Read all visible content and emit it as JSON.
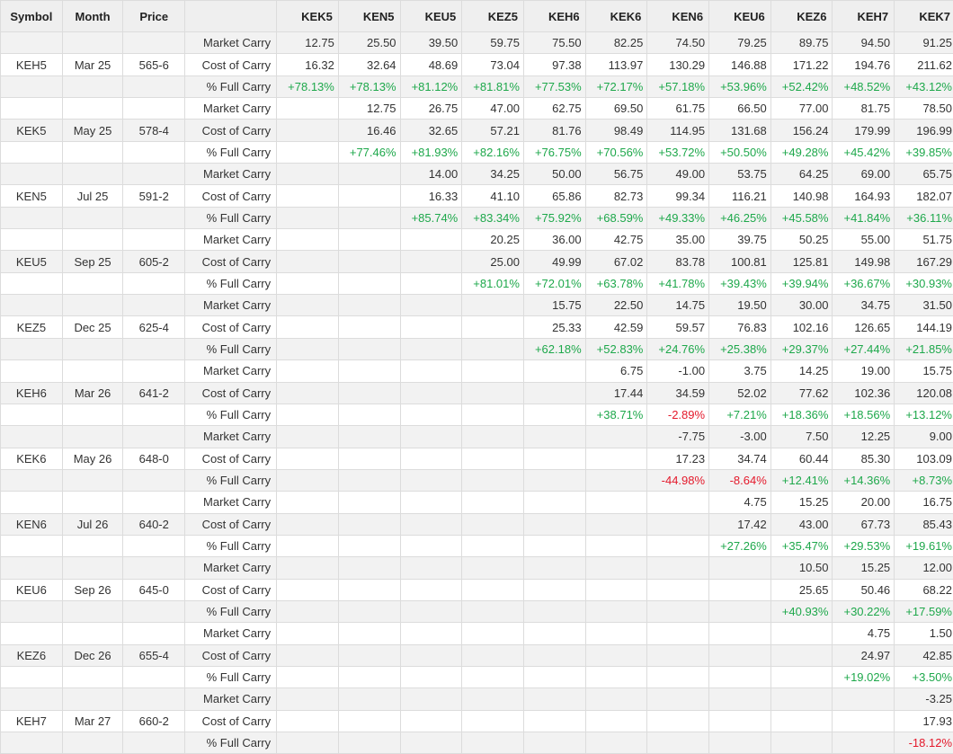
{
  "colors": {
    "positive": "#1ea84b",
    "negative": "#e4192b",
    "header_bg": "#efefef",
    "stripe": "#f2f2f2"
  },
  "headers": {
    "symbol": "Symbol",
    "month": "Month",
    "price": "Price",
    "type": "",
    "columns": [
      "KEK5",
      "KEN5",
      "KEU5",
      "KEZ5",
      "KEH6",
      "KEK6",
      "KEN6",
      "KEU6",
      "KEZ6",
      "KEH7",
      "KEK7"
    ]
  },
  "groups": [
    {
      "symbol": "KEH5",
      "month": "Mar 25",
      "price": "565-6",
      "rows": [
        {
          "label": "Market Carry",
          "values": [
            "12.75",
            "25.50",
            "39.50",
            "59.75",
            "75.50",
            "82.25",
            "74.50",
            "79.25",
            "89.75",
            "94.50",
            "91.25"
          ]
        },
        {
          "label": "Cost of Carry",
          "values": [
            "16.32",
            "32.64",
            "48.69",
            "73.04",
            "97.38",
            "113.97",
            "130.29",
            "146.88",
            "171.22",
            "194.76",
            "211.62"
          ]
        },
        {
          "label": "% Full Carry",
          "values": [
            "+78.13%",
            "+78.13%",
            "+81.12%",
            "+81.81%",
            "+77.53%",
            "+72.17%",
            "+57.18%",
            "+53.96%",
            "+52.42%",
            "+48.52%",
            "+43.12%"
          ]
        }
      ]
    },
    {
      "symbol": "KEK5",
      "month": "May 25",
      "price": "578-4",
      "rows": [
        {
          "label": "Market Carry",
          "values": [
            "",
            "12.75",
            "26.75",
            "47.00",
            "62.75",
            "69.50",
            "61.75",
            "66.50",
            "77.00",
            "81.75",
            "78.50"
          ]
        },
        {
          "label": "Cost of Carry",
          "values": [
            "",
            "16.46",
            "32.65",
            "57.21",
            "81.76",
            "98.49",
            "114.95",
            "131.68",
            "156.24",
            "179.99",
            "196.99"
          ]
        },
        {
          "label": "% Full Carry",
          "values": [
            "",
            "+77.46%",
            "+81.93%",
            "+82.16%",
            "+76.75%",
            "+70.56%",
            "+53.72%",
            "+50.50%",
            "+49.28%",
            "+45.42%",
            "+39.85%"
          ]
        }
      ]
    },
    {
      "symbol": "KEN5",
      "month": "Jul 25",
      "price": "591-2",
      "rows": [
        {
          "label": "Market Carry",
          "values": [
            "",
            "",
            "14.00",
            "34.25",
            "50.00",
            "56.75",
            "49.00",
            "53.75",
            "64.25",
            "69.00",
            "65.75"
          ]
        },
        {
          "label": "Cost of Carry",
          "values": [
            "",
            "",
            "16.33",
            "41.10",
            "65.86",
            "82.73",
            "99.34",
            "116.21",
            "140.98",
            "164.93",
            "182.07"
          ]
        },
        {
          "label": "% Full Carry",
          "values": [
            "",
            "",
            "+85.74%",
            "+83.34%",
            "+75.92%",
            "+68.59%",
            "+49.33%",
            "+46.25%",
            "+45.58%",
            "+41.84%",
            "+36.11%"
          ]
        }
      ]
    },
    {
      "symbol": "KEU5",
      "month": "Sep 25",
      "price": "605-2",
      "rows": [
        {
          "label": "Market Carry",
          "values": [
            "",
            "",
            "",
            "20.25",
            "36.00",
            "42.75",
            "35.00",
            "39.75",
            "50.25",
            "55.00",
            "51.75"
          ]
        },
        {
          "label": "Cost of Carry",
          "values": [
            "",
            "",
            "",
            "25.00",
            "49.99",
            "67.02",
            "83.78",
            "100.81",
            "125.81",
            "149.98",
            "167.29"
          ]
        },
        {
          "label": "% Full Carry",
          "values": [
            "",
            "",
            "",
            "+81.01%",
            "+72.01%",
            "+63.78%",
            "+41.78%",
            "+39.43%",
            "+39.94%",
            "+36.67%",
            "+30.93%"
          ]
        }
      ]
    },
    {
      "symbol": "KEZ5",
      "month": "Dec 25",
      "price": "625-4",
      "rows": [
        {
          "label": "Market Carry",
          "values": [
            "",
            "",
            "",
            "",
            "15.75",
            "22.50",
            "14.75",
            "19.50",
            "30.00",
            "34.75",
            "31.50"
          ]
        },
        {
          "label": "Cost of Carry",
          "values": [
            "",
            "",
            "",
            "",
            "25.33",
            "42.59",
            "59.57",
            "76.83",
            "102.16",
            "126.65",
            "144.19"
          ]
        },
        {
          "label": "% Full Carry",
          "values": [
            "",
            "",
            "",
            "",
            "+62.18%",
            "+52.83%",
            "+24.76%",
            "+25.38%",
            "+29.37%",
            "+27.44%",
            "+21.85%"
          ]
        }
      ]
    },
    {
      "symbol": "KEH6",
      "month": "Mar 26",
      "price": "641-2",
      "rows": [
        {
          "label": "Market Carry",
          "values": [
            "",
            "",
            "",
            "",
            "",
            "6.75",
            "-1.00",
            "3.75",
            "14.25",
            "19.00",
            "15.75"
          ]
        },
        {
          "label": "Cost of Carry",
          "values": [
            "",
            "",
            "",
            "",
            "",
            "17.44",
            "34.59",
            "52.02",
            "77.62",
            "102.36",
            "120.08"
          ]
        },
        {
          "label": "% Full Carry",
          "values": [
            "",
            "",
            "",
            "",
            "",
            "+38.71%",
            "-2.89%",
            "+7.21%",
            "+18.36%",
            "+18.56%",
            "+13.12%"
          ]
        }
      ]
    },
    {
      "symbol": "KEK6",
      "month": "May 26",
      "price": "648-0",
      "rows": [
        {
          "label": "Market Carry",
          "values": [
            "",
            "",
            "",
            "",
            "",
            "",
            "-7.75",
            "-3.00",
            "7.50",
            "12.25",
            "9.00"
          ]
        },
        {
          "label": "Cost of Carry",
          "values": [
            "",
            "",
            "",
            "",
            "",
            "",
            "17.23",
            "34.74",
            "60.44",
            "85.30",
            "103.09"
          ]
        },
        {
          "label": "% Full Carry",
          "values": [
            "",
            "",
            "",
            "",
            "",
            "",
            "-44.98%",
            "-8.64%",
            "+12.41%",
            "+14.36%",
            "+8.73%"
          ]
        }
      ]
    },
    {
      "symbol": "KEN6",
      "month": "Jul 26",
      "price": "640-2",
      "rows": [
        {
          "label": "Market Carry",
          "values": [
            "",
            "",
            "",
            "",
            "",
            "",
            "",
            "4.75",
            "15.25",
            "20.00",
            "16.75"
          ]
        },
        {
          "label": "Cost of Carry",
          "values": [
            "",
            "",
            "",
            "",
            "",
            "",
            "",
            "17.42",
            "43.00",
            "67.73",
            "85.43"
          ]
        },
        {
          "label": "% Full Carry",
          "values": [
            "",
            "",
            "",
            "",
            "",
            "",
            "",
            "+27.26%",
            "+35.47%",
            "+29.53%",
            "+19.61%"
          ]
        }
      ]
    },
    {
      "symbol": "KEU6",
      "month": "Sep 26",
      "price": "645-0",
      "rows": [
        {
          "label": "Market Carry",
          "values": [
            "",
            "",
            "",
            "",
            "",
            "",
            "",
            "",
            "10.50",
            "15.25",
            "12.00"
          ]
        },
        {
          "label": "Cost of Carry",
          "values": [
            "",
            "",
            "",
            "",
            "",
            "",
            "",
            "",
            "25.65",
            "50.46",
            "68.22"
          ]
        },
        {
          "label": "% Full Carry",
          "values": [
            "",
            "",
            "",
            "",
            "",
            "",
            "",
            "",
            "+40.93%",
            "+30.22%",
            "+17.59%"
          ]
        }
      ]
    },
    {
      "symbol": "KEZ6",
      "month": "Dec 26",
      "price": "655-4",
      "rows": [
        {
          "label": "Market Carry",
          "values": [
            "",
            "",
            "",
            "",
            "",
            "",
            "",
            "",
            "",
            "4.75",
            "1.50"
          ]
        },
        {
          "label": "Cost of Carry",
          "values": [
            "",
            "",
            "",
            "",
            "",
            "",
            "",
            "",
            "",
            "24.97",
            "42.85"
          ]
        },
        {
          "label": "% Full Carry",
          "values": [
            "",
            "",
            "",
            "",
            "",
            "",
            "",
            "",
            "",
            "+19.02%",
            "+3.50%"
          ]
        }
      ]
    },
    {
      "symbol": "KEH7",
      "month": "Mar 27",
      "price": "660-2",
      "rows": [
        {
          "label": "Market Carry",
          "values": [
            "",
            "",
            "",
            "",
            "",
            "",
            "",
            "",
            "",
            "",
            "-3.25"
          ]
        },
        {
          "label": "Cost of Carry",
          "values": [
            "",
            "",
            "",
            "",
            "",
            "",
            "",
            "",
            "",
            "",
            "17.93"
          ]
        },
        {
          "label": "% Full Carry",
          "values": [
            "",
            "",
            "",
            "",
            "",
            "",
            "",
            "",
            "",
            "",
            "-18.12%"
          ]
        }
      ]
    }
  ]
}
